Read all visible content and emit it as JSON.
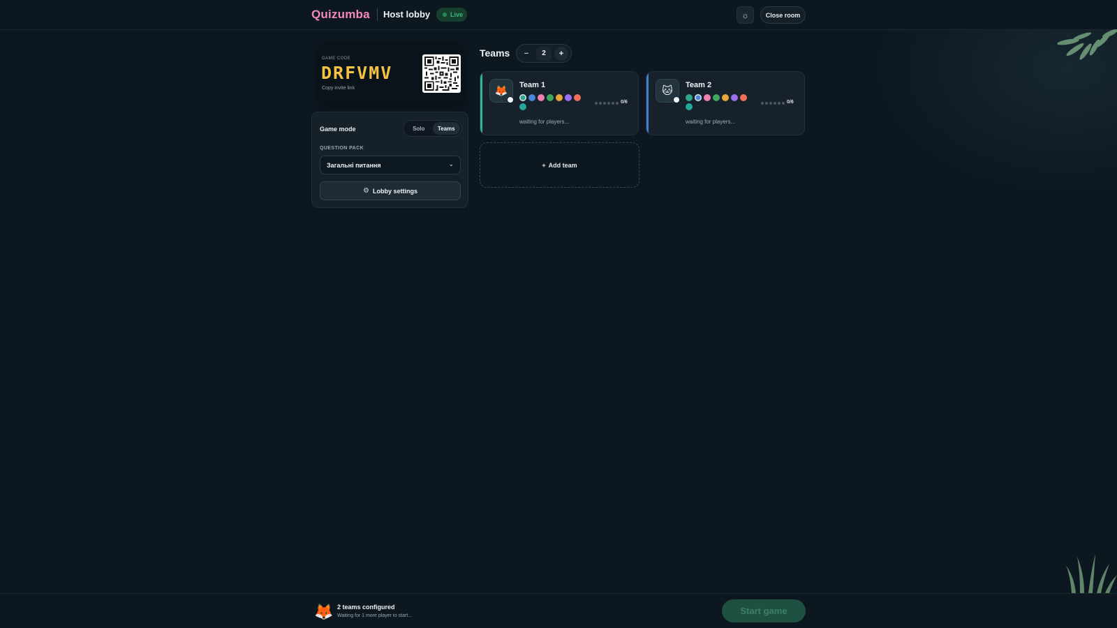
{
  "header": {
    "brand": "Quizumba",
    "title": "Host lobby",
    "live_label": "Live",
    "theme_icon": "sun-icon",
    "close_room_label": "Close room"
  },
  "invite": {
    "code_label": "GAME CODE",
    "code": "DRFVMV",
    "copy_link_label": "Copy invite link",
    "qr_icon": "qr-code"
  },
  "settings": {
    "game_mode_label": "Game mode",
    "mode_options": [
      "Solo",
      "Teams"
    ],
    "selected_mode": "Teams",
    "question_pack_label": "QUESTION PACK",
    "question_pack_value": "Загальні питання",
    "lobby_settings_label": "Lobby settings"
  },
  "teams_section": {
    "title": "Teams",
    "count": "2",
    "decrement_label": "−",
    "increment_label": "+",
    "add_team_label": "Add team",
    "teams": [
      {
        "name": "Team 1",
        "avatar": "🦊",
        "accent": "#2fb58f",
        "players": "0/6",
        "status": "waiting for players...",
        "colors": [
          "#2fa58a",
          "#4a86d8",
          "#f07fb1",
          "#3fa85e",
          "#e8a53a",
          "#9a6ff0",
          "#ef7058",
          "#22a79a"
        ],
        "selected_color": 0
      },
      {
        "name": "Team 2",
        "avatar": "🐱",
        "accent": "#3f7fd4",
        "players": "0/6",
        "status": "waiting for players...",
        "colors": [
          "#2fa58a",
          "#4a86d8",
          "#f07fb1",
          "#3fa85e",
          "#e8a53a",
          "#9a6ff0",
          "#ef7058",
          "#22a79a"
        ],
        "selected_color": 1
      }
    ]
  },
  "footer": {
    "title": "2 teams configured",
    "subtitle": "Waiting for 1 more player to start...",
    "start_label": "Start game",
    "avatar": "🦊"
  }
}
